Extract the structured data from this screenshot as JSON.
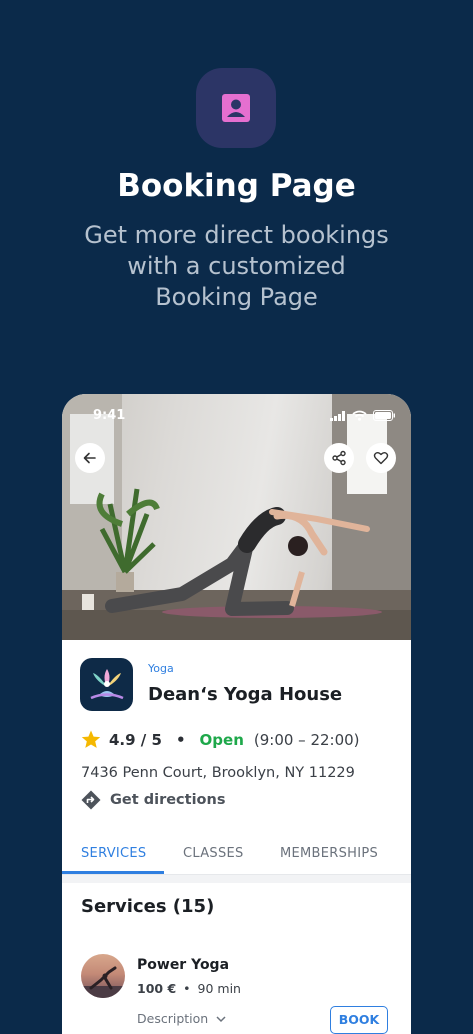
{
  "hero": {
    "icon": "contact-card-icon",
    "title": "Booking Page",
    "subtitle_line1": "Get more direct bookings",
    "subtitle_line2": "with a customized",
    "subtitle_line3": "Booking Page",
    "icon_bg": "#2c3566",
    "icon_color": "#e56fd0"
  },
  "phone": {
    "status_time": "9:41",
    "business": {
      "category": "Yoga",
      "name": "Dean‘s Yoga House",
      "rating": "4.9 / 5",
      "status": "Open",
      "hours": "(9:00 – 22:00)",
      "address": "7436 Penn Court, Brooklyn, NY 11229",
      "directions_label": "Get directions"
    },
    "tabs": [
      "SERVICES",
      "CLASSES",
      "MEMBERSHIPS"
    ],
    "services": {
      "heading": "Services (15)",
      "items": [
        {
          "name": "Power Yoga",
          "price": "100 €",
          "duration": "90 min",
          "description_label": "Description",
          "book_label": "BOOK"
        }
      ]
    }
  },
  "colors": {
    "background": "#0b2a4a",
    "accent": "#2f7fe0",
    "open_green": "#1ea84a",
    "star": "#f5b800"
  }
}
